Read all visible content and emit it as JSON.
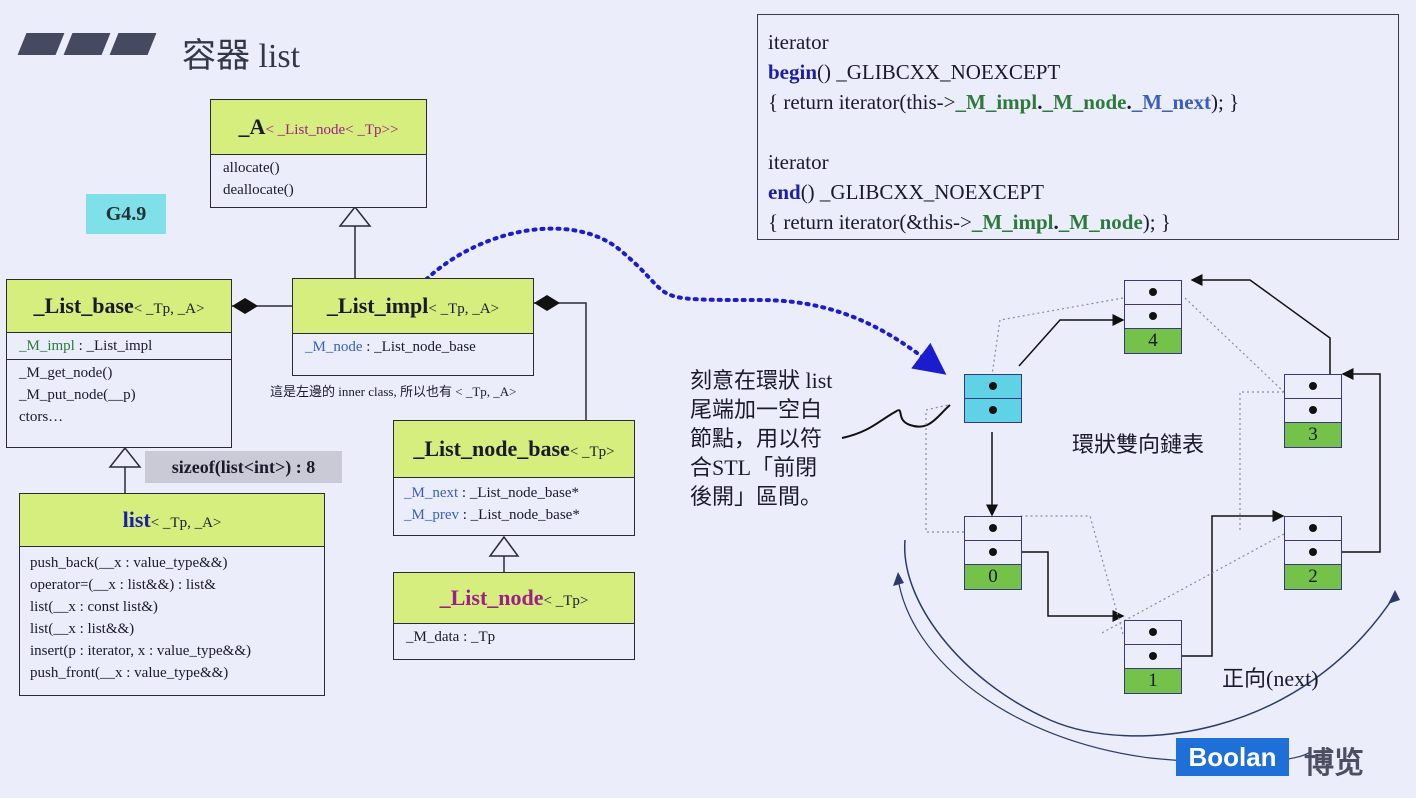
{
  "page": {
    "title_zh": "容器",
    "title_en": "list",
    "version_badge": "G4.9"
  },
  "code": {
    "line1": "iterator",
    "line2_kw": "begin",
    "line2_rest": "() _GLIBCXX_NOEXCEPT",
    "line3_a": "{ return iterator(this->",
    "line3_b": "_M_impl",
    "line3_c": ".",
    "line3_d": "_M_node",
    "line3_e": ".",
    "line3_f": "_M_next",
    "line3_g": "); }",
    "line4": "iterator",
    "line5_kw": "end",
    "line5_rest": "() _GLIBCXX_NOEXCEPT",
    "line6_a": "{ return iterator(&this->",
    "line6_b": "_M_impl",
    "line6_c": ".",
    "line6_d": "_M_node",
    "line6_e": "); }"
  },
  "allocator": {
    "name": "_A",
    "tmpl": "< _List_node< _Tp>>",
    "methods": [
      "allocate()",
      "deallocate()"
    ]
  },
  "list_base": {
    "name": "_List_base",
    "tmpl": "< _Tp, _A>",
    "member_a": "_M_impl",
    "member_b": " : _List_impl",
    "methods": [
      "_M_get_node()",
      "_M_put_node(__p)",
      "ctors…"
    ]
  },
  "list_impl": {
    "name": "_List_impl",
    "tmpl": "< _Tp, _A>",
    "member_a": "_M_node",
    "member_b": " : _List_node_base"
  },
  "inner_note": "這是左邊的 inner class, 所以也有 < _Tp, _A>",
  "sizeof_label": "sizeof(list<int>) : 8",
  "list_cls": {
    "name": "list",
    "tmpl": "< _Tp, _A>",
    "methods": [
      "push_back(__x : value_type&&)",
      "operator=(__x : list&&) : list&",
      "list(__x : const list&)",
      "list(__x : list&&)",
      "insert(p : iterator, x : value_type&&)",
      "push_front(__x : value_type&&)"
    ]
  },
  "node_base": {
    "name": "_List_node_base",
    "tmpl": "< _Tp>",
    "next_a": "_M_next",
    "next_b": " : _List_node_base*",
    "prev_a": "_M_prev",
    "prev_b": " : _List_node_base*"
  },
  "node": {
    "name": "_List_node",
    "tmpl": "< _Tp>",
    "member": "_M_data : _Tp"
  },
  "annotation": [
    "刻意在環狀 list",
    "尾端加一空白",
    "節點，用以符",
    "合STL「前閉",
    "後開」區間。"
  ],
  "ring_label": "環狀雙向鏈表",
  "forward_label": "正向(next)",
  "node_labels": [
    "0",
    "1",
    "2",
    "3",
    "4"
  ],
  "logo": {
    "en": "Boolan",
    "zh": "博览"
  },
  "colors": {
    "header_green": "#d6ee7e",
    "node_green": "#74c24a",
    "empty_cyan": "#5fd2e6",
    "dotted_blue": "#1c1ccf"
  }
}
